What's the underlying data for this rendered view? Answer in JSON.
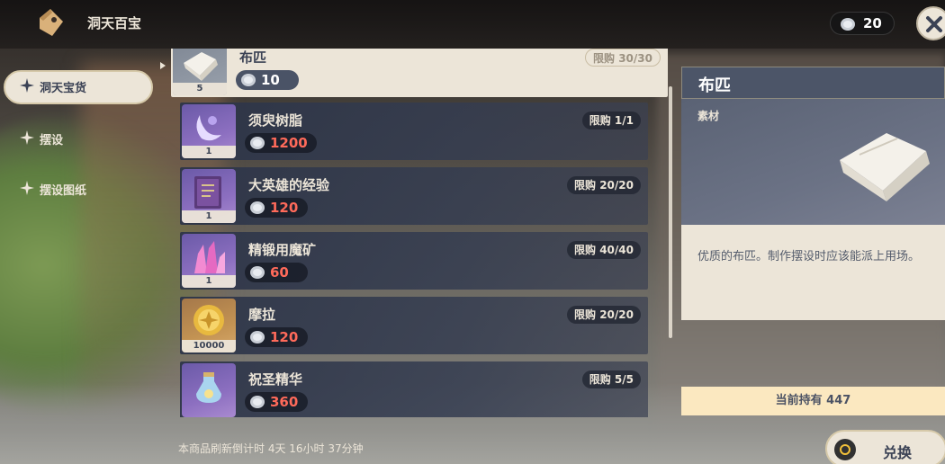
{
  "header": {
    "title": "洞天百宝",
    "currency_icon": "realm-currency-coin-icon",
    "currency_amount": "20",
    "close_icon": "close-icon"
  },
  "sidebar": {
    "items": [
      {
        "label": "洞天宝货",
        "active": true
      },
      {
        "label": "摆设",
        "active": false
      },
      {
        "label": "摆设图纸",
        "active": false
      }
    ]
  },
  "shop": {
    "items": [
      {
        "name": "布匹",
        "price": "10",
        "limit": "限购 30/30",
        "qty": "5",
        "icon": "cloth-icon",
        "selected": true
      },
      {
        "name": "须臾树脂",
        "price": "1200",
        "limit": "限购 1/1",
        "qty": "1",
        "icon": "transient-resin-icon",
        "selected": false
      },
      {
        "name": "大英雄的经验",
        "price": "120",
        "limit": "限购 20/20",
        "qty": "1",
        "icon": "heros-wit-book-icon",
        "selected": false
      },
      {
        "name": "精锻用魔矿",
        "price": "60",
        "limit": "限购 40/40",
        "qty": "1",
        "icon": "mystic-enhancement-ore-icon",
        "selected": false
      },
      {
        "name": "摩拉",
        "price": "120",
        "limit": "限购 20/20",
        "qty": "10000",
        "icon": "mora-coin-icon",
        "selected": false
      },
      {
        "name": "祝圣精华",
        "price": "360",
        "limit": "限购 5/5",
        "qty": "",
        "icon": "sanctifying-essence-icon",
        "selected": false
      }
    ]
  },
  "detail": {
    "title": "布匹",
    "type": "素材",
    "description": "优质的布匹。制作摆设时应该能派上用场。",
    "holding": "当前持有 447"
  },
  "footer": {
    "refresh_text": "本商品刷新倒计时 4天 16小时 37分钟",
    "exchange_label": "兑换"
  },
  "colors": {
    "price_red": "#ff6a5a",
    "panel_cream": "#ece5d8",
    "row_navy": "#2c3448",
    "holding_bg": "#fbe8c0"
  }
}
